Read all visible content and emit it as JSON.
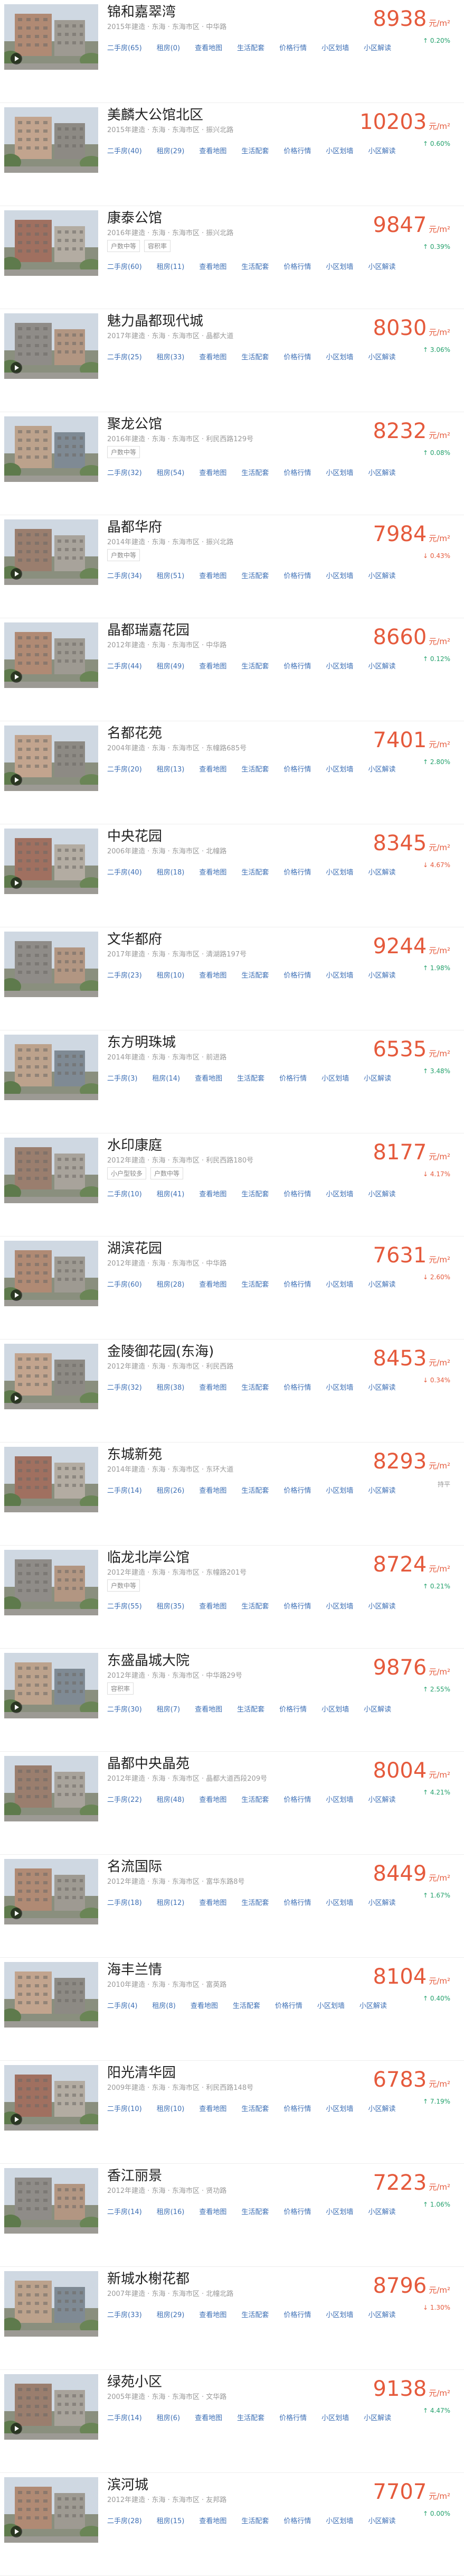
{
  "link_labels": [
    "二手房",
    "租房",
    "查看地图",
    "生活配套",
    "价格行情",
    "小区划墙",
    "小区解读"
  ],
  "colors": {
    "price": "#e55a3c",
    "rise": "#22a06b",
    "link": "#3d6fb5"
  },
  "listings": [
    {
      "name": "锦和嘉翠湾",
      "meta": "2015年建造 · 东海 · 东海市区 · 中华路",
      "tags": [],
      "price": "8938",
      "unit": "元/m²",
      "change": "↑ 0.20%",
      "trend": "up",
      "video": true,
      "second_hand": "二手房(65)",
      "rent": "租房(0)"
    },
    {
      "name": "美麟大公馆北区",
      "meta": "2015年建造 · 东海 · 东海市区 · 振兴北路",
      "tags": [],
      "price": "10203",
      "unit": "元/m²",
      "change": "↑ 0.60%",
      "trend": "up",
      "video": false,
      "second_hand": "二手房(40)",
      "rent": "租房(29)"
    },
    {
      "name": "康泰公馆",
      "meta": "2016年建造 · 东海 · 东海市区 · 振兴北路",
      "tags": [
        "户数中等",
        "容积率"
      ],
      "price": "9847",
      "unit": "元/m²",
      "change": "↑ 0.39%",
      "trend": "up",
      "video": false,
      "second_hand": "二手房(60)",
      "rent": "租房(11)"
    },
    {
      "name": "魅力晶都现代城",
      "meta": "2017年建造 · 东海 · 东海市区 · 晶都大道",
      "tags": [],
      "price": "8030",
      "unit": "元/m²",
      "change": "↑ 3.06%",
      "trend": "up",
      "video": true,
      "second_hand": "二手房(25)",
      "rent": "租房(33)"
    },
    {
      "name": "聚龙公馆",
      "meta": "2016年建造 · 东海 · 东海市区 · 利民西路129号",
      "tags": [
        "户数中等"
      ],
      "price": "8232",
      "unit": "元/m²",
      "change": "↑ 0.08%",
      "trend": "up",
      "video": false,
      "second_hand": "二手房(32)",
      "rent": "租房(54)"
    },
    {
      "name": "晶都华府",
      "meta": "2014年建造 · 东海 · 东海市区 · 振兴北路",
      "tags": [
        "户数中等"
      ],
      "price": "7984",
      "unit": "元/m²",
      "change": "↓ 0.43%",
      "trend": "down",
      "video": true,
      "second_hand": "二手房(34)",
      "rent": "租房(51)"
    },
    {
      "name": "晶都瑞嘉花园",
      "meta": "2012年建造 · 东海 · 东海市区 · 中华路",
      "tags": [],
      "price": "8660",
      "unit": "元/m²",
      "change": "↑ 0.12%",
      "trend": "up",
      "video": true,
      "second_hand": "二手房(44)",
      "rent": "租房(49)"
    },
    {
      "name": "名都花苑",
      "meta": "2004年建造 · 东海 · 东海市区 · 东幢路685号",
      "tags": [],
      "price": "7401",
      "unit": "元/m²",
      "change": "↑ 2.80%",
      "trend": "up",
      "video": true,
      "second_hand": "二手房(20)",
      "rent": "租房(13)"
    },
    {
      "name": "中央花园",
      "meta": "2006年建造 · 东海 · 东海市区 · 北幢路",
      "tags": [],
      "price": "8345",
      "unit": "元/m²",
      "change": "↓ 4.67%",
      "trend": "down",
      "video": true,
      "second_hand": "二手房(40)",
      "rent": "租房(18)"
    },
    {
      "name": "文华都府",
      "meta": "2017年建造 · 东海 · 东海市区 · 清湖路197号",
      "tags": [],
      "price": "9244",
      "unit": "元/m²",
      "change": "↑ 1.98%",
      "trend": "up",
      "video": false,
      "second_hand": "二手房(23)",
      "rent": "租房(10)"
    },
    {
      "name": "东方明珠城",
      "meta": "2014年建造 · 东海 · 东海市区 · 前进路",
      "tags": [],
      "price": "6535",
      "unit": "元/m²",
      "change": "↑ 3.48%",
      "trend": "up",
      "video": false,
      "second_hand": "二手房(3)",
      "rent": "租房(14)"
    },
    {
      "name": "水印康庭",
      "meta": "2012年建造 · 东海 · 东海市区 · 利民西路180号",
      "tags": [
        "小户型较多",
        "户数中等"
      ],
      "price": "8177",
      "unit": "元/m²",
      "change": "↓ 4.17%",
      "trend": "down",
      "video": false,
      "second_hand": "二手房(10)",
      "rent": "租房(41)"
    },
    {
      "name": "湖滨花园",
      "meta": "2012年建造 · 东海 · 东海市区 · 中华路",
      "tags": [],
      "price": "7631",
      "unit": "元/m²",
      "change": "↓ 2.60%",
      "trend": "down",
      "video": true,
      "second_hand": "二手房(60)",
      "rent": "租房(28)"
    },
    {
      "name": "金陵御花园(东海)",
      "meta": "2012年建造 · 东海 · 东海市区 · 利民西路",
      "tags": [],
      "price": "8453",
      "unit": "元/m²",
      "change": "↓ 0.34%",
      "trend": "down",
      "video": true,
      "second_hand": "二手房(32)",
      "rent": "租房(38)"
    },
    {
      "name": "东城新苑",
      "meta": "2014年建造 · 东海 · 东海市区 · 东环大道",
      "tags": [],
      "price": "8293",
      "unit": "元/m²",
      "change": "持平",
      "trend": "flat",
      "video": false,
      "second_hand": "二手房(14)",
      "rent": "租房(26)"
    },
    {
      "name": "临龙北岸公馆",
      "meta": "2012年建造 · 东海 · 东海市区 · 东幢路201号",
      "tags": [
        "户数中等"
      ],
      "price": "8724",
      "unit": "元/m²",
      "change": "↑ 0.21%",
      "trend": "up",
      "video": false,
      "second_hand": "二手房(55)",
      "rent": "租房(35)"
    },
    {
      "name": "东盛晶城大院",
      "meta": "2012年建造 · 东海 · 东海市区 · 中华路29号",
      "tags": [
        "容积率"
      ],
      "price": "9876",
      "unit": "元/m²",
      "change": "↑ 2.55%",
      "trend": "up",
      "video": true,
      "second_hand": "二手房(30)",
      "rent": "租房(7)"
    },
    {
      "name": "晶都中央晶苑",
      "meta": "2012年建造 · 东海 · 东海市区 · 晶都大道西段209号",
      "tags": [],
      "price": "8004",
      "unit": "元/m²",
      "change": "↑ 4.21%",
      "trend": "up",
      "video": false,
      "second_hand": "二手房(22)",
      "rent": "租房(48)"
    },
    {
      "name": "名流国际",
      "meta": "2012年建造 · 东海 · 东海市区 · 富华东路8号",
      "tags": [],
      "price": "8449",
      "unit": "元/m²",
      "change": "↑ 1.67%",
      "trend": "up",
      "video": true,
      "second_hand": "二手房(18)",
      "rent": "租房(12)"
    },
    {
      "name": "海丰兰情",
      "meta": "2010年建造 · 东海 · 东海市区 · 富英路",
      "tags": [],
      "price": "8104",
      "unit": "元/m²",
      "change": "↑ 0.40%",
      "trend": "up",
      "video": false,
      "second_hand": "二手房(4)",
      "rent": "租房(8)"
    },
    {
      "name": "阳光清华园",
      "meta": "2009年建造 · 东海 · 东海市区 · 利民西路148号",
      "tags": [],
      "price": "6783",
      "unit": "元/m²",
      "change": "↑ 7.19%",
      "trend": "up",
      "video": true,
      "second_hand": "二手房(10)",
      "rent": "租房(10)"
    },
    {
      "name": "香江丽景",
      "meta": "2012年建造 · 东海 · 东海市区 · 贤功路",
      "tags": [],
      "price": "7223",
      "unit": "元/m²",
      "change": "↑ 1.06%",
      "trend": "up",
      "video": false,
      "second_hand": "二手房(14)",
      "rent": "租房(16)"
    },
    {
      "name": "新城水榭花都",
      "meta": "2007年建造 · 东海 · 东海市区 · 北幢北路",
      "tags": [],
      "price": "8796",
      "unit": "元/m²",
      "change": "↓ 1.30%",
      "trend": "down",
      "video": false,
      "second_hand": "二手房(33)",
      "rent": "租房(29)"
    },
    {
      "name": "绿苑小区",
      "meta": "2005年建造 · 东海 · 东海市区 · 文华路",
      "tags": [],
      "price": "9138",
      "unit": "元/m²",
      "change": "↑ 4.47%",
      "trend": "up",
      "video": true,
      "second_hand": "二手房(14)",
      "rent": "租房(6)"
    },
    {
      "name": "滨河城",
      "meta": "2012年建造 · 东海 · 东海市区 · 友邦路",
      "tags": [],
      "price": "7707",
      "unit": "元/m²",
      "change": "↑ 0.00%",
      "trend": "up",
      "video": true,
      "second_hand": "二手房(28)",
      "rent": "租房(15)"
    }
  ]
}
